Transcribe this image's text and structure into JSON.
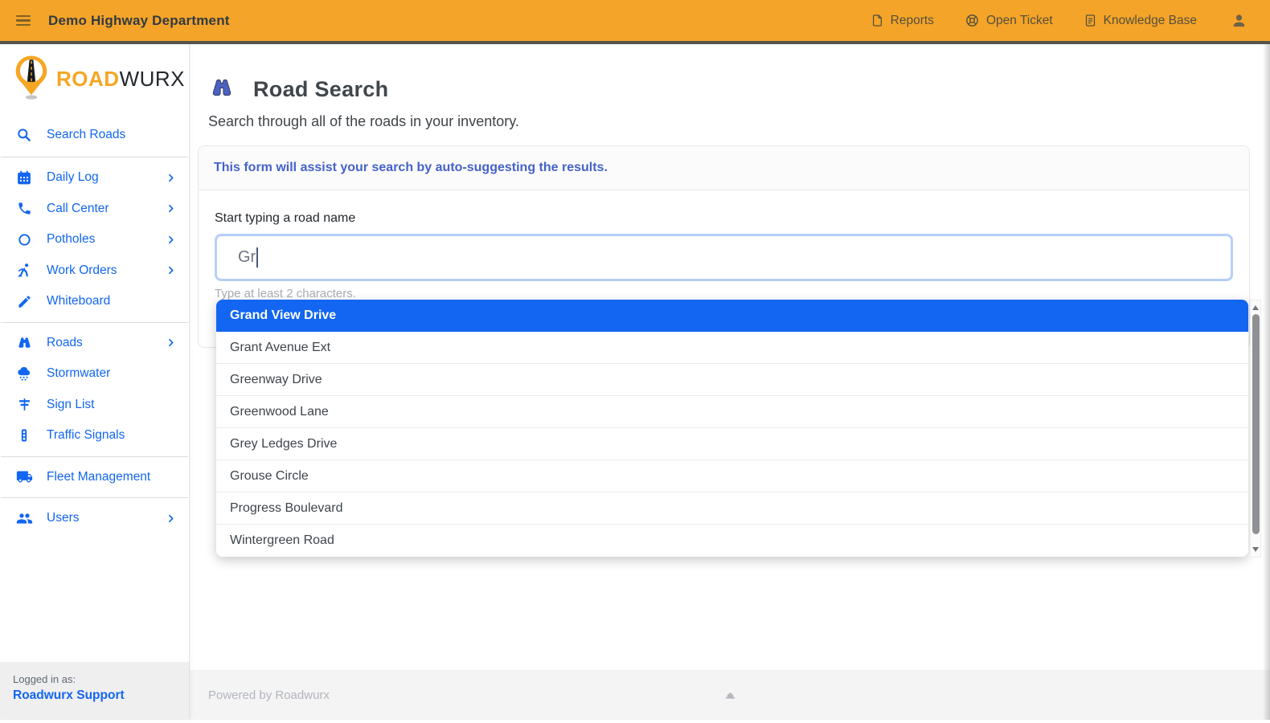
{
  "topbar": {
    "menu_icon": "hamburger-icon",
    "title": "Demo Highway Department",
    "links": [
      {
        "label": "Reports",
        "icon": "file-icon"
      },
      {
        "label": "Open Ticket",
        "icon": "life-ring-icon"
      },
      {
        "label": "Knowledge Base",
        "icon": "doc-text-icon"
      }
    ],
    "user_icon": "user-icon"
  },
  "sidebar": {
    "logo_road": "ROAD",
    "logo_wurx": "WURX",
    "logo_icon": "map-pin-road-icon",
    "items": [
      {
        "label": "Search Roads",
        "icon": "search-icon",
        "chevron": false
      },
      {
        "label": "Daily Log",
        "icon": "calendar-icon",
        "chevron": true
      },
      {
        "label": "Call Center",
        "icon": "phone-icon",
        "chevron": true
      },
      {
        "label": "Potholes",
        "icon": "circle-icon",
        "chevron": true
      },
      {
        "label": "Work Orders",
        "icon": "worker-icon",
        "chevron": true
      },
      {
        "label": "Whiteboard",
        "icon": "pen-icon",
        "chevron": false
      },
      {
        "label": "Roads",
        "icon": "binoculars-icon",
        "chevron": true
      },
      {
        "label": "Stormwater",
        "icon": "rain-cloud-icon",
        "chevron": false
      },
      {
        "label": "Sign List",
        "icon": "street-sign-icon",
        "chevron": false
      },
      {
        "label": "Traffic Signals",
        "icon": "traffic-light-icon",
        "chevron": false
      },
      {
        "label": "Fleet Management",
        "icon": "truck-icon",
        "chevron": false
      },
      {
        "label": "Users",
        "icon": "users-icon",
        "chevron": true
      }
    ],
    "logged_in_label": "Logged in as:",
    "logged_in_user": "Roadwurx Support"
  },
  "page": {
    "title": "Road Search",
    "title_icon": "binoculars-icon",
    "subtitle": "Search through all of the roads in your inventory."
  },
  "form": {
    "info": "This form will assist your search by auto-suggesting the results.",
    "field_label": "Start typing a road name",
    "value": "Gr",
    "hint": "Type at least 2 characters."
  },
  "suggestions": {
    "selected_index": 0,
    "selected": "Grand View Drive",
    "items": [
      "Grand View Drive",
      "Grant Avenue Ext",
      "Greenway Drive",
      "Greenwood Lane",
      "Grey Ledges Drive",
      "Grouse Circle",
      "Progress Boulevard",
      "Wintergreen Road"
    ]
  },
  "footer": {
    "powered_by": "Powered by Roadwurx",
    "icon": "hard-hat-icon"
  },
  "colors": {
    "topbar_orange": "#f4a428",
    "primary_blue": "#1266f1",
    "selected_option_bg": "#1266f1",
    "logo_orange": "#f5a623",
    "info_text_blue": "#4462ca",
    "input_focus_border": "#b5cefb"
  }
}
